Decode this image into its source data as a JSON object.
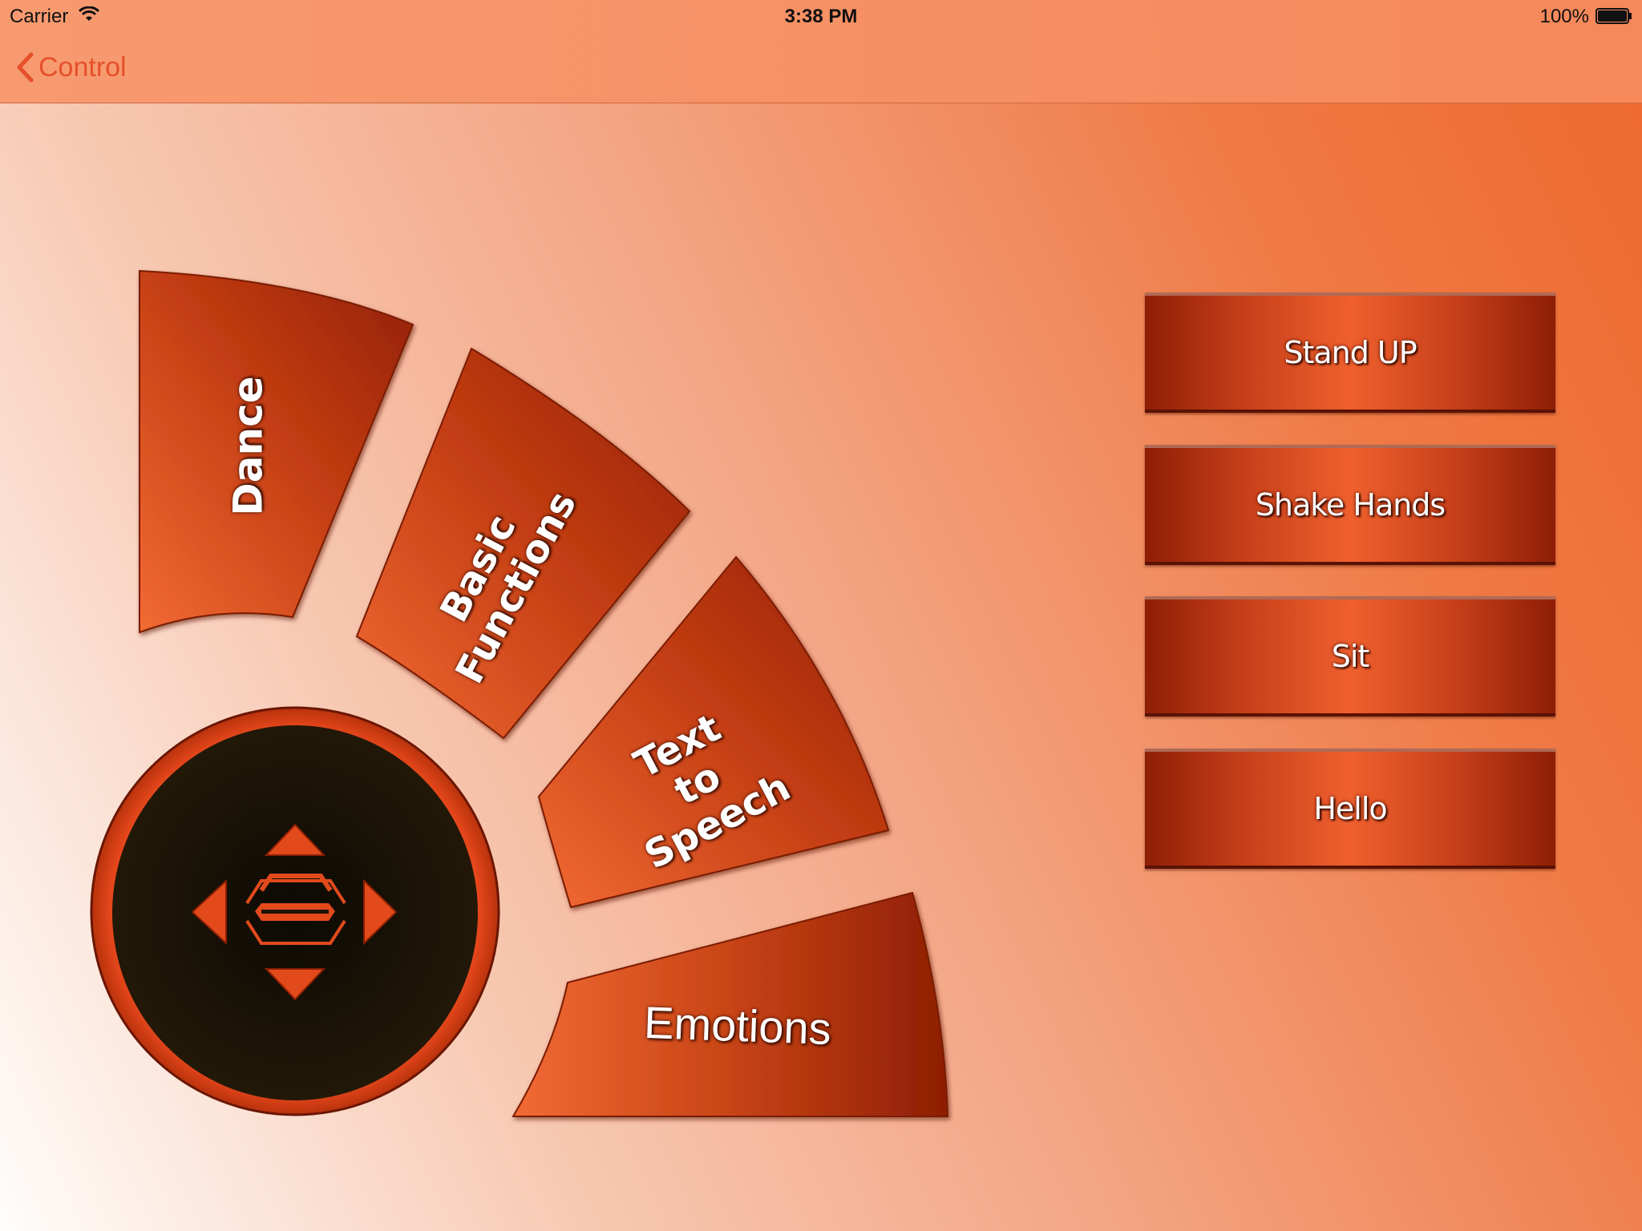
{
  "status_bar": {
    "carrier": "Carrier",
    "time": "3:38 PM",
    "battery": "100%"
  },
  "nav": {
    "back_label": "Control"
  },
  "menu": {
    "dance": "Dance",
    "basic_functions_line1": "Basic",
    "basic_functions_line2": "Functions",
    "tts_line1": "Text",
    "tts_line2": "to",
    "tts_line3": "Speech",
    "emotions": "Emotions"
  },
  "actions": [
    {
      "label": "Stand UP"
    },
    {
      "label": "Shake Hands"
    },
    {
      "label": "Sit"
    },
    {
      "label": "Hello"
    }
  ],
  "colors": {
    "accent": "#e6502a",
    "button_dark": "#8e1e06",
    "button_light": "#f0602e",
    "joystick_bg": "#1c1406"
  },
  "icons": [
    "wifi-icon",
    "battery-icon",
    "chevron-left-icon",
    "arrow-up-icon",
    "arrow-down-icon",
    "arrow-left-icon",
    "arrow-right-icon",
    "center-hexagon-icon"
  ]
}
